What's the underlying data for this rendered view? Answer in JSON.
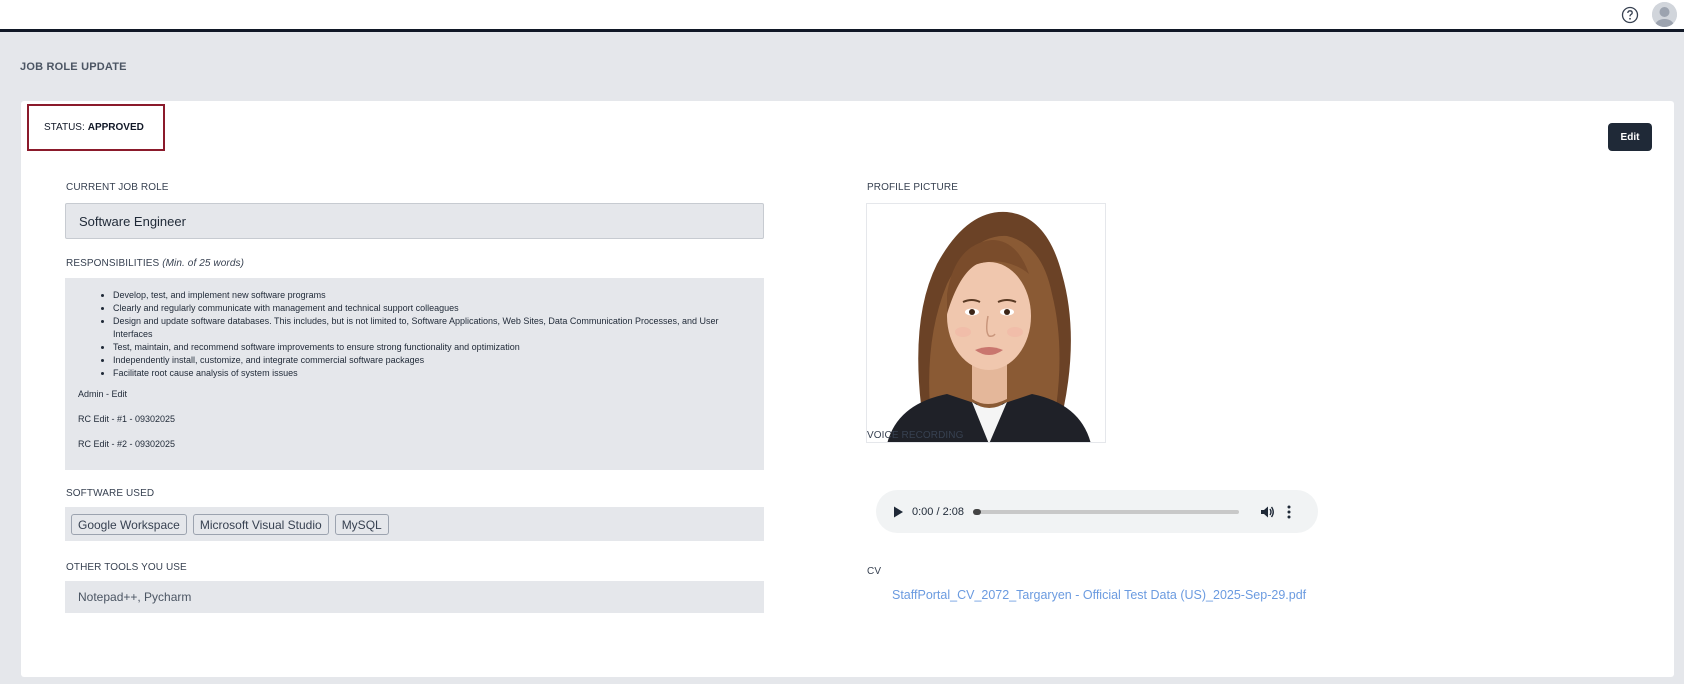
{
  "header": {
    "help_icon": "question-circle-icon",
    "avatar_icon": "user-avatar-icon"
  },
  "page": {
    "title": "JOB ROLE UPDATE"
  },
  "status": {
    "label": "STATUS:",
    "value": "APPROVED",
    "border_color": "#8b1a2b"
  },
  "actions": {
    "edit_label": "Edit"
  },
  "current_job_role": {
    "label": "CURRENT JOB ROLE",
    "value": "Software Engineer"
  },
  "responsibilities": {
    "label": "RESPONSIBILITIES",
    "hint": "(Min. of 25 words)",
    "items": [
      "Develop, test, and implement new software programs",
      "Clearly and regularly communicate with management and technical support colleagues",
      "Design and update software databases. This includes, but is not limited to, Software Applications, Web Sites, Data Communication Processes, and User Interfaces",
      "Test, maintain, and recommend software improvements to ensure strong functionality and optimization",
      "Independently install, customize, and integrate commercial software packages",
      "Facilitate root cause analysis of system issues"
    ],
    "notes": [
      "Admin - Edit",
      "RC Edit - #1 - 09302025",
      "RC Edit - #2 - 09302025"
    ]
  },
  "software_used": {
    "label": "SOFTWARE USED",
    "items": [
      "Google Workspace",
      "Microsoft Visual Studio",
      "MySQL"
    ]
  },
  "other_tools": {
    "label": "OTHER TOOLS YOU USE",
    "value": "Notepad++, Pycharm"
  },
  "profile_picture": {
    "label": "PROFILE PICTURE"
  },
  "voice_recording": {
    "label": "VOICE RECORDING",
    "time": "0:00 / 2:08",
    "progress": 0.0
  },
  "cv": {
    "label": "CV",
    "filename": "StaffPortal_CV_2072_Targaryen - Official Test Data (US)_2025-Sep-29.pdf",
    "link_color": "#6b9be0"
  }
}
